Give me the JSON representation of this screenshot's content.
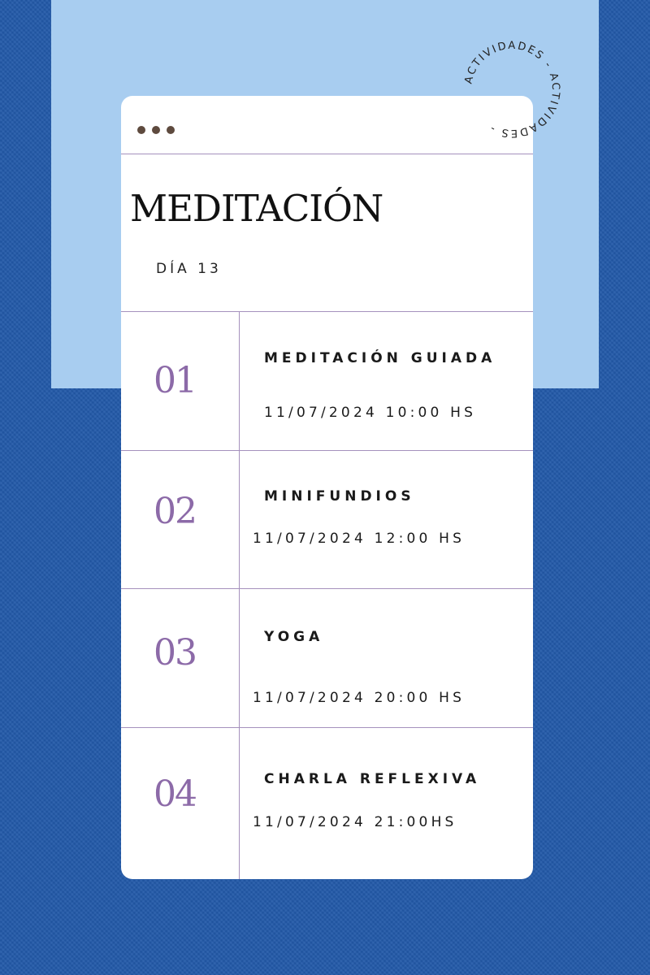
{
  "badge": {
    "text": "ACTIVIDADES - ACTIVIDADES - "
  },
  "header": {
    "title": "MEDITACIÓN",
    "subtitle": "DÍA 13"
  },
  "activities": [
    {
      "number": "01",
      "title": "MEDITACIÓN GUIADA",
      "datetime": "11/07/2024 10:00 HS"
    },
    {
      "number": "02",
      "title": "MINIFUNDIOS",
      "datetime": "11/07/2024 12:00 HS"
    },
    {
      "number": "03",
      "title": "YOGA",
      "datetime": "11/07/2024 20:00 HS"
    },
    {
      "number": "04",
      "title": "CHARLA REFLEXIVA",
      "datetime": "11/07/2024 21:00HS"
    }
  ],
  "colors": {
    "background": "#2259a8",
    "panel": "#a8cdf0",
    "accent_purple": "#8c6aa8",
    "dots": "#5e4a3e"
  }
}
